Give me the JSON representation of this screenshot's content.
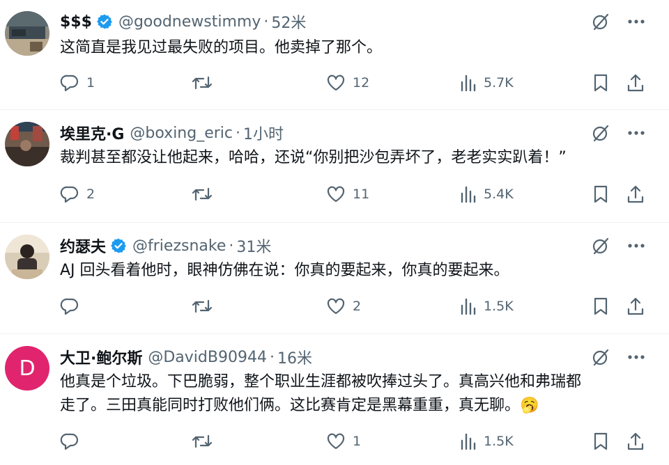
{
  "tweets": [
    {
      "name": "$$$",
      "verified": true,
      "handle": "@goodnewstimmy",
      "sep": "·",
      "time": "52米",
      "text": "这简直是我见过最失败的项目。他卖掉了那个。",
      "replies": "1",
      "retweets": "",
      "likes": "12",
      "views": "5.7K",
      "avatar": "photo"
    },
    {
      "name": "埃里克·G",
      "verified": false,
      "handle": "@boxing_eric",
      "sep": "·",
      "time": "1小时",
      "text": "裁判甚至都没让他起来，哈哈，还说“你别把沙包弄坏了，老老实实趴着！”",
      "replies": "2",
      "retweets": "",
      "likes": "11",
      "views": "5.4K",
      "avatar": "photo"
    },
    {
      "name": "约瑟夫",
      "verified": true,
      "handle": "@friezsnake",
      "sep": "·",
      "time": "31米",
      "text": "AJ 回头看着他时，眼神仿佛在说：你真的要起来，你真的要起来。",
      "replies": "",
      "retweets": "",
      "likes": "2",
      "views": "1.5K",
      "avatar": "photo"
    },
    {
      "name": "大卫·鲍尔斯",
      "verified": false,
      "handle": "@DavidB90944",
      "sep": "·",
      "time": "16米",
      "text_line1": "他真是个垃圾。下巴脆弱，整个职业生涯都被吹捧过头了。真高兴他和弗瑞都",
      "text_line2": "走了。三田真能同时打败他们俩。这比赛肯定是黑幕重重，真无聊。",
      "emoji": "🥱",
      "replies": "",
      "retweets": "",
      "likes": "1",
      "views": "1.5K",
      "avatar_letter": "D"
    }
  ],
  "colors": {
    "text": "#0f1419",
    "secondary": "#536471",
    "verified": "#1d9bf0",
    "avatar_d": "#e0256e",
    "divider": "#eff3f4"
  },
  "icons": [
    "reply-icon",
    "retweet-icon",
    "like-icon",
    "views-icon",
    "bookmark-icon",
    "share-icon",
    "grok-icon",
    "more-icon",
    "verified-badge-icon"
  ]
}
